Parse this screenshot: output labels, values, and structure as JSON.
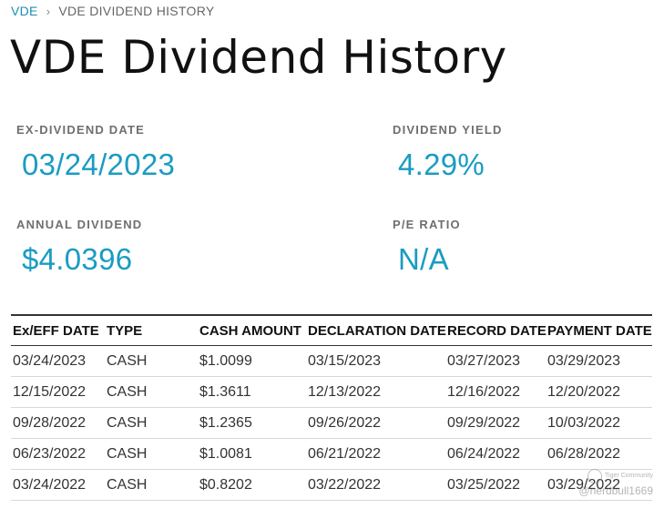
{
  "breadcrumb": {
    "link": "VDE",
    "separator": "›",
    "current": "VDE DIVIDEND HISTORY"
  },
  "title": "VDE Dividend History",
  "stats": {
    "ex_dividend": {
      "label": "EX-DIVIDEND DATE",
      "value": "03/24/2023"
    },
    "dividend_yield": {
      "label": "DIVIDEND YIELD",
      "value": "4.29%"
    },
    "annual_dividend": {
      "label": "ANNUAL DIVIDEND",
      "value": "$4.0396"
    },
    "pe_ratio": {
      "label": "P/E RATIO",
      "value": "N/A"
    }
  },
  "table": {
    "headers": [
      "Ex/EFF DATE",
      "TYPE",
      "CASH AMOUNT",
      "DECLARATION DATE",
      "RECORD DATE",
      "PAYMENT DATE"
    ],
    "rows": [
      [
        "03/24/2023",
        "CASH",
        "$1.0099",
        "03/15/2023",
        "03/27/2023",
        "03/29/2023"
      ],
      [
        "12/15/2022",
        "CASH",
        "$1.3611",
        "12/13/2022",
        "12/16/2022",
        "12/20/2022"
      ],
      [
        "09/28/2022",
        "CASH",
        "$1.2365",
        "09/26/2022",
        "09/29/2022",
        "10/03/2022"
      ],
      [
        "06/23/2022",
        "CASH",
        "$1.0081",
        "06/21/2022",
        "06/24/2022",
        "06/28/2022"
      ],
      [
        "03/24/2022",
        "CASH",
        "$0.8202",
        "03/22/2022",
        "03/25/2022",
        "03/29/2022"
      ]
    ]
  },
  "watermark": {
    "brand": "Tiger Community",
    "handle": "@nerdbull1669"
  },
  "colors": {
    "accent": "#1a9cc2",
    "link": "#1a8fb0"
  }
}
